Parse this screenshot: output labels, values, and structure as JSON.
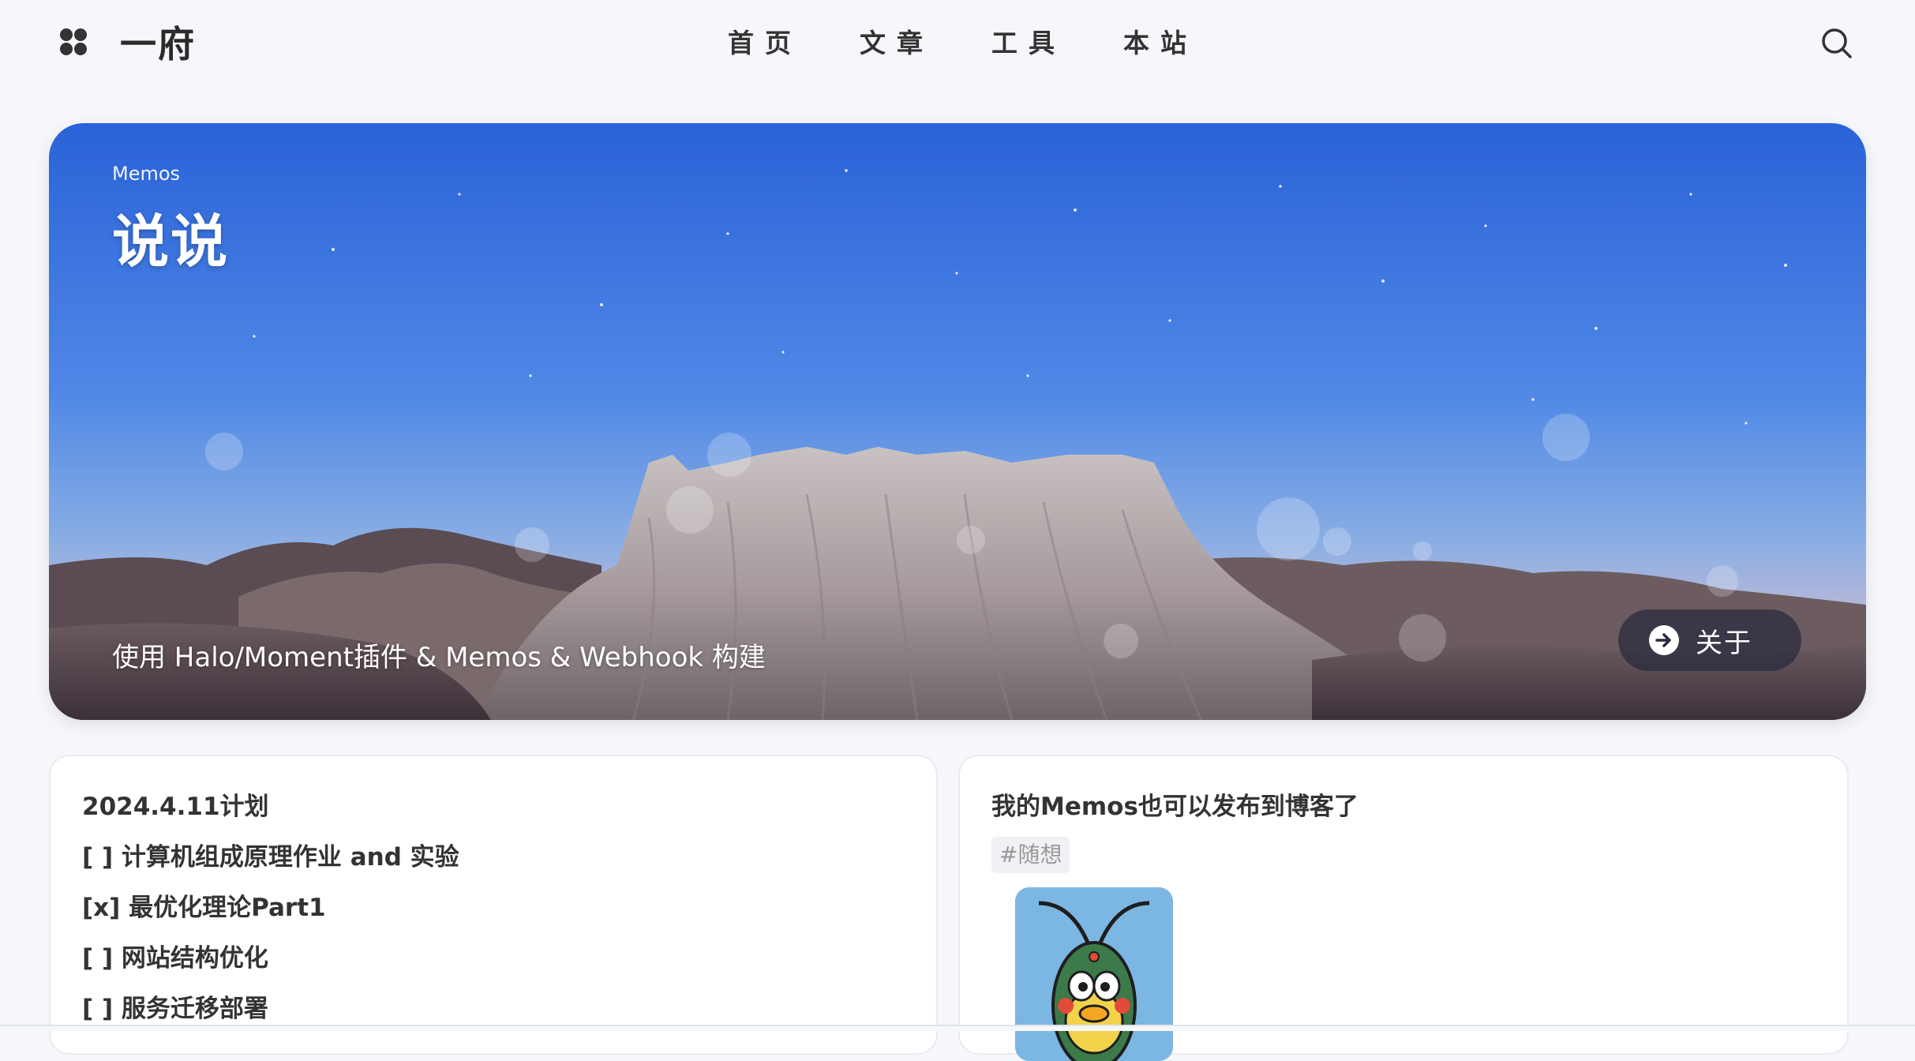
{
  "nav": {
    "site_name": "一府",
    "menu": [
      "首页",
      "文章",
      "工具",
      "本站"
    ]
  },
  "hero": {
    "subtitle": "Memos",
    "title": "说说",
    "description": "使用 Halo/Moment插件 & Memos & Webhook 构建",
    "button_label": "关于"
  },
  "memos": [
    {
      "lines": [
        "2024.4.11计划",
        "[ ] 计算机组成原理作业 and 实验",
        "[x] 最优化理论Part1",
        "[ ] 网站结构优化",
        "[ ] 服务迁移部署"
      ]
    },
    {
      "title": "我的Memos也可以发布到博客了",
      "tag": "#随想"
    }
  ],
  "colors": {
    "page_bg": "#f6f7fb",
    "sky_top": "#2f6fe0",
    "sky_bottom": "#8fb3e6",
    "button_bg": "#282a3c"
  }
}
